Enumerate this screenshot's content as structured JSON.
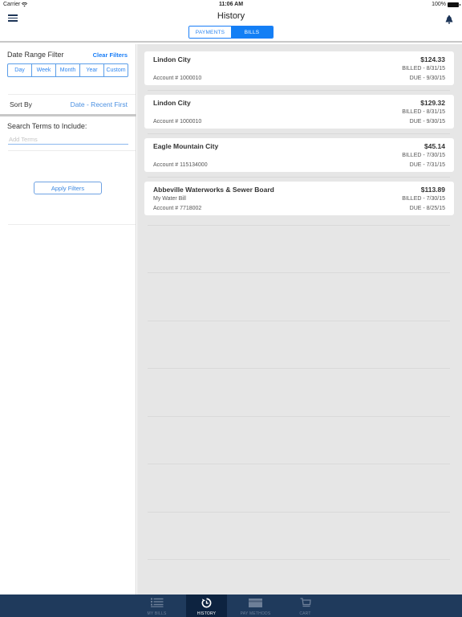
{
  "status_bar": {
    "carrier": "Carrier",
    "time": "11:06 AM",
    "battery": "100%"
  },
  "nav": {
    "title": "History",
    "segments": [
      {
        "label": "PAYMENTS",
        "active": false
      },
      {
        "label": "BILLS",
        "active": true
      }
    ]
  },
  "sidebar": {
    "date_range_label": "Date Range Filter",
    "clear_filters": "Clear Filters",
    "ranges": [
      "Day",
      "Week",
      "Month",
      "Year",
      "Custom"
    ],
    "sort_label": "Sort By",
    "sort_value": "Date - Recent First",
    "search_label": "Search Terms to Include:",
    "search_placeholder": "Add Terms",
    "search_value": "",
    "apply_button": "Apply Filters"
  },
  "bills": [
    {
      "name": "Lindon City",
      "subtitle": "",
      "account": "Account # 1000010",
      "amount": "$124.33",
      "billed": "BILLED - 8/31/15",
      "due": "DUE - 9/30/15"
    },
    {
      "name": "Lindon City",
      "subtitle": "",
      "account": "Account # 1000010",
      "amount": "$129.32",
      "billed": "BILLED - 8/31/15",
      "due": "DUE - 9/30/15"
    },
    {
      "name": "Eagle Mountain City",
      "subtitle": "",
      "account": "Account # 115134000",
      "amount": "$45.14",
      "billed": "BILLED - 7/30/15",
      "due": "DUE - 7/31/15"
    },
    {
      "name": "Abbeville Waterworks & Sewer Board",
      "subtitle": "My Water Bill",
      "account": "Account # 7718002",
      "amount": "$113.89",
      "billed": "BILLED - 7/30/15",
      "due": "DUE - 8/25/15"
    }
  ],
  "tab_bar": {
    "tabs": [
      {
        "label": "MY BILLS",
        "icon": "list-icon",
        "active": false
      },
      {
        "label": "HISTORY",
        "icon": "history-icon",
        "active": true
      },
      {
        "label": "PAY METHODS",
        "icon": "credit-card-icon",
        "active": false
      },
      {
        "label": "CART",
        "icon": "cart-icon",
        "active": false
      }
    ]
  },
  "colors": {
    "accent": "#137ff5",
    "tab_bar": "#1f3a5c",
    "tab_active": "#0d2340",
    "content_bg": "#e6e6e6"
  }
}
